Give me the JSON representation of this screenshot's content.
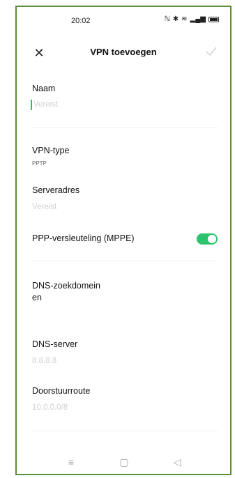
{
  "status_bar": {
    "time": "20:02",
    "icons": [
      "nfc-icon",
      "bluetooth-icon",
      "wifi-icon",
      "signal-icon",
      "battery-icon"
    ]
  },
  "toolbar": {
    "title": "VPN toevoegen",
    "close_icon": "close-icon",
    "confirm_icon": "check-icon"
  },
  "form": {
    "name": {
      "label": "Naam",
      "placeholder": "Vereist"
    },
    "vpn_type": {
      "label": "VPN-type",
      "value": "PPTP"
    },
    "server": {
      "label": "Serveradres",
      "placeholder": "Vereist"
    },
    "ppp_encryption": {
      "label": "PPP-versleuteling (MPPE)",
      "enabled": true
    },
    "dns_domain": {
      "label": "DNS-zoekdomein\nen"
    },
    "dns_server": {
      "label": "DNS-server",
      "placeholder": "8.8.8.8"
    },
    "forward_route": {
      "label": "Doorstuurroute",
      "placeholder": "10.0.0.0/8"
    }
  },
  "colors": {
    "accent": "#2bc46c",
    "frame": "#5a8f3c",
    "placeholder": "#d2d2d2"
  },
  "nav": [
    "menu-icon",
    "home-icon",
    "back-icon"
  ]
}
